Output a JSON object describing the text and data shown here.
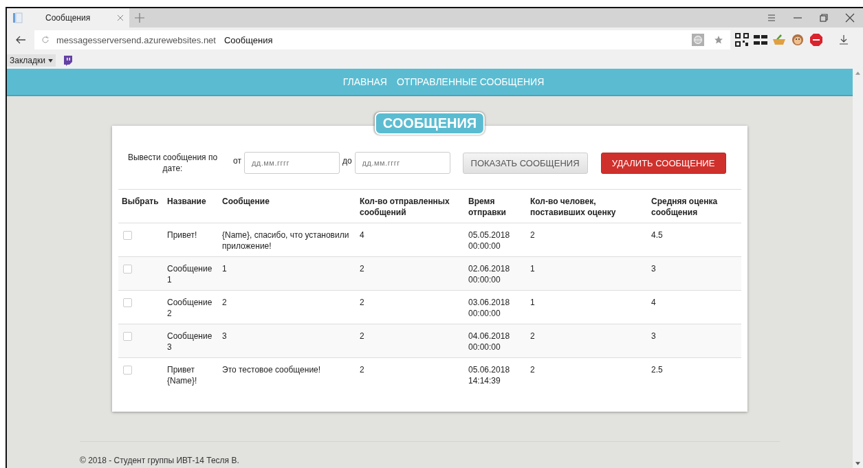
{
  "browser": {
    "tab_title": "Сообщения",
    "url_host": "messagesserversend.azurewebsites.net",
    "url_title": "Сообщения",
    "bookmarks_label": "Закладки"
  },
  "nav": {
    "links": [
      {
        "label": "ГЛАВНАЯ"
      },
      {
        "label": "ОТПРАВЛЕННЫЕ СООБЩЕНИЯ"
      }
    ]
  },
  "heading": "СООБЩЕНИЯ",
  "filter": {
    "label": "Вывести сообщения по дате:",
    "from_label": "от",
    "from_placeholder": "дд.мм.гггг",
    "to_label": "до",
    "to_placeholder": "дд.мм.гггг",
    "show_button": "ПОКАЗАТЬ СООБЩЕНИЯ",
    "delete_button": "УДАЛИТЬ СООБЩЕНИЕ"
  },
  "table": {
    "select_header": "Выбрать",
    "columns": [
      "Название",
      "Сообщение",
      "Кол-во отправленных сообщений",
      "Время отправки",
      "Кол-во человек, поставивших оценку",
      "Средняя оценка сообщения"
    ],
    "rows": [
      {
        "checked": false,
        "cells": [
          "Привет!",
          "{Name}, спасибо, что установили приложение!",
          "4",
          "05.05.2018 00:00:00",
          "2",
          "4.5"
        ]
      },
      {
        "checked": false,
        "cells": [
          "Сообщение 1",
          "1",
          "2",
          "02.06.2018 00:00:00",
          "1",
          "3"
        ]
      },
      {
        "checked": false,
        "cells": [
          "Сообщение 2",
          "2",
          "2",
          "03.06.2018 00:00:00",
          "1",
          "4"
        ]
      },
      {
        "checked": false,
        "cells": [
          "Сообщение 3",
          "3",
          "2",
          "04.06.2018 00:00:00",
          "2",
          "3"
        ]
      },
      {
        "checked": false,
        "cells": [
          "Привет {Name}!",
          "Это тестовое сообщение!",
          "2",
          "05.06.2018 14:14:39",
          "2",
          "2.5"
        ]
      }
    ]
  },
  "footer": "© 2018 - Студент группы ИВТ-14 Тесля В."
}
